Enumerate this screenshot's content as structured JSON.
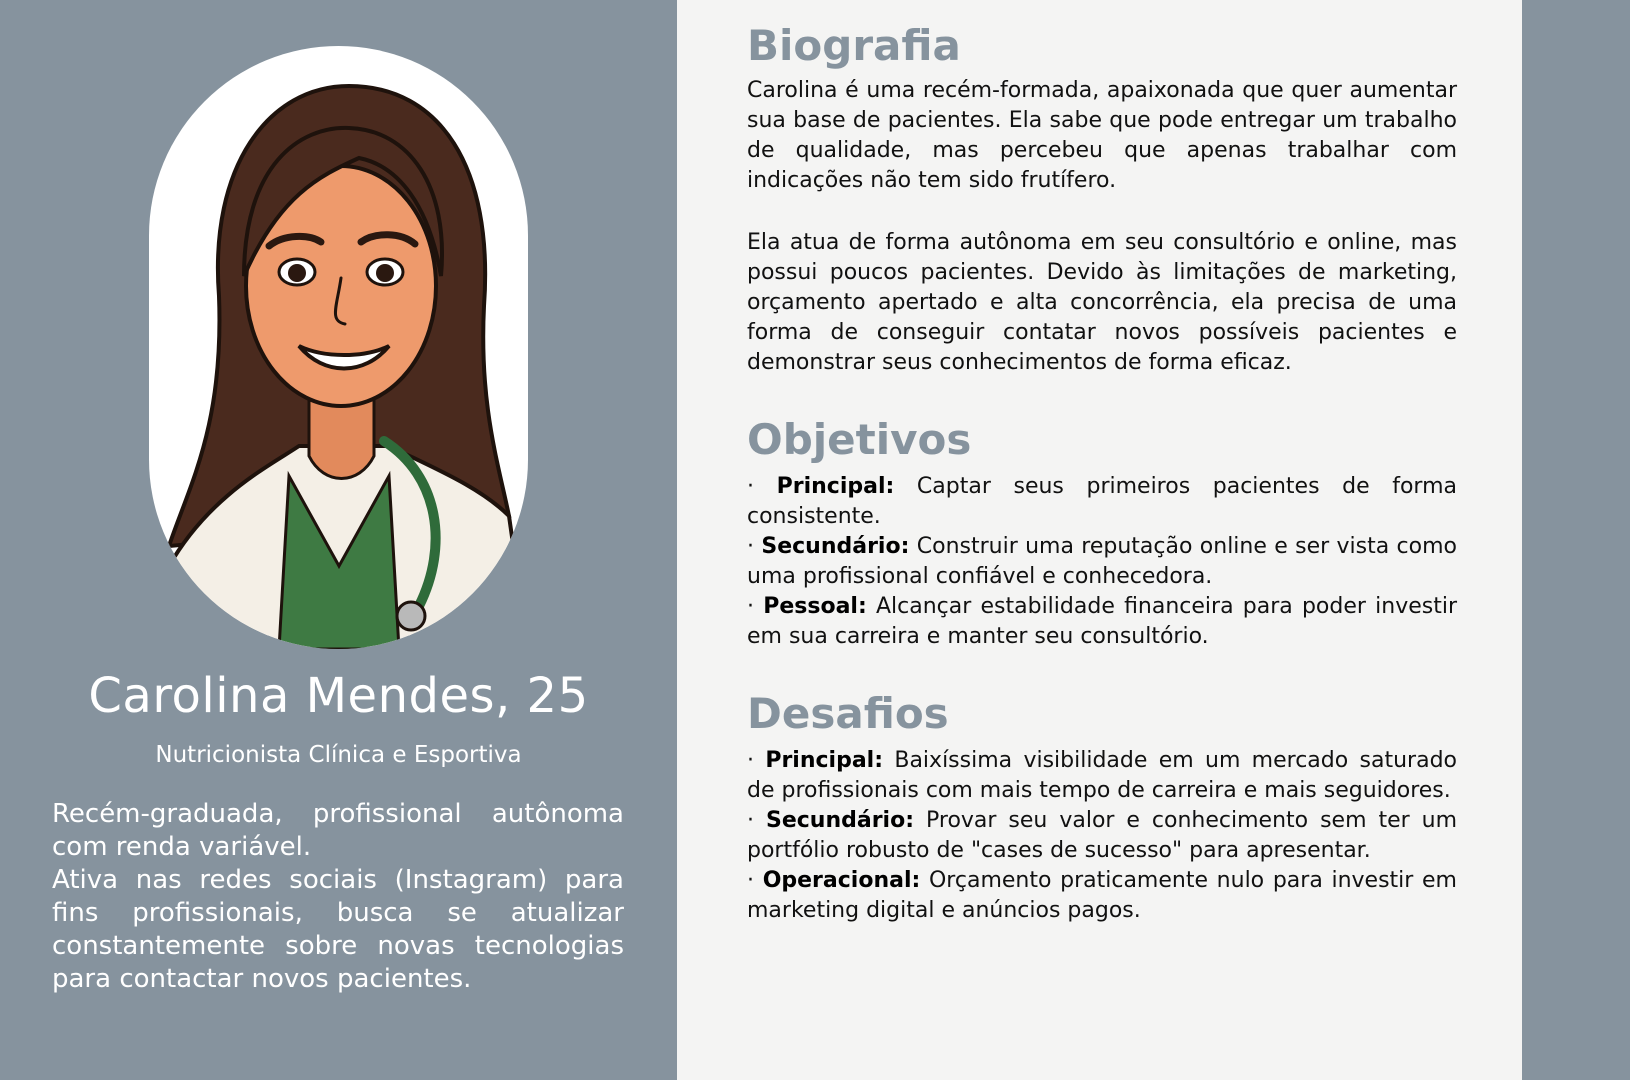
{
  "persona": {
    "name": "Carolina Mendes, 25",
    "role": "Nutricionista Clínica e Esportiva",
    "summary": [
      "Recém-graduada, profissional autônoma com renda variável.",
      "Ativa nas redes sociais (Instagram) para fins profissionais, busca se atualizar constantemente sobre novas tecnologias para contactar novos pacientes."
    ]
  },
  "biografia": {
    "heading": "Biografia",
    "paragraphs": [
      "Carolina é uma recém-formada, apaixonada que quer aumentar sua base de pacientes. Ela sabe que pode entregar um trabalho de qualidade, mas percebeu que apenas trabalhar com indicações não tem sido frutífero.",
      "Ela atua de forma autônoma em seu consultório e online, mas possui poucos pacientes. Devido às limitações de marketing, orçamento apertado e alta concorrência, ela precisa de uma forma de conseguir contatar novos possíveis pacientes e demonstrar seus conhecimentos de forma eficaz."
    ]
  },
  "objetivos": {
    "heading": "Objetivos",
    "items": [
      {
        "bullet": "·",
        "label": "Principal:",
        "text": "Captar seus primeiros pacientes de forma consistente."
      },
      {
        "bullet": "·",
        "label": "Secundário:",
        "text": "Construir uma reputação online e ser vista como uma profissional confiável e conhecedora."
      },
      {
        "bullet": "·",
        "label": "Pessoal:",
        "text": "Alcançar estabilidade financeira para poder investir em sua carreira e manter seu consultório."
      }
    ]
  },
  "desafios": {
    "heading": "Desafios",
    "items": [
      {
        "bullet": "·",
        "label": "Principal:",
        "text": "Baixíssima visibilidade em um mercado saturado de profissionais com mais tempo de carreira e mais seguidores."
      },
      {
        "bullet": "·",
        "label": "Secundário:",
        "text": "Provar seu valor e conhecimento sem ter um portfólio robusto de \"cases de sucesso\" para apresentar."
      },
      {
        "bullet": "·",
        "label": "Operacional:",
        "text": "Orçamento praticamente nulo para investir em marketing digital e anúncios pagos."
      }
    ]
  },
  "colors": {
    "left_background": "#86939E",
    "right_background": "#f4f4f3",
    "heading": "#86939E",
    "portrait_frame": "#ffffff"
  },
  "icons": {
    "portrait": "illustrated-avatar-doctor-with-stethoscope"
  }
}
